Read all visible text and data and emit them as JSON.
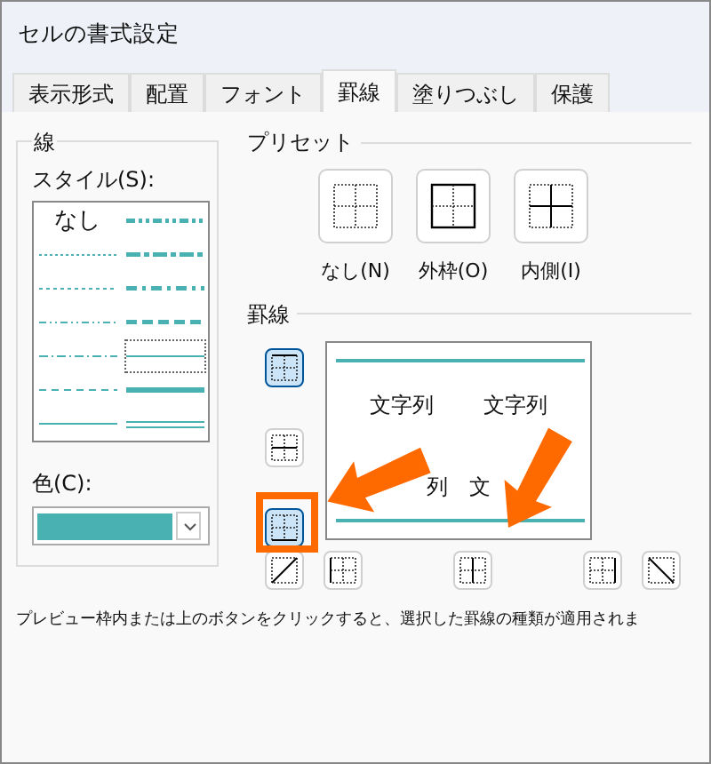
{
  "window": {
    "title": "セルの書式設定"
  },
  "tabs": [
    {
      "label": "表示形式",
      "selected": false
    },
    {
      "label": "配置",
      "selected": false
    },
    {
      "label": "フォント",
      "selected": false
    },
    {
      "label": "罫線",
      "selected": true
    },
    {
      "label": "塗りつぶし",
      "selected": false
    },
    {
      "label": "保護",
      "selected": false
    }
  ],
  "line": {
    "group_label": "線",
    "style_label": "スタイル(S):",
    "styles": [
      {
        "kind": "none",
        "label": "なし",
        "selected": false
      },
      {
        "kind": "hair",
        "selected": false
      },
      {
        "kind": "dotted",
        "selected": false
      },
      {
        "kind": "dashdotdot",
        "selected": false
      },
      {
        "kind": "dashdot",
        "selected": false
      },
      {
        "kind": "dashed",
        "selected": false
      },
      {
        "kind": "thin",
        "selected": false
      },
      {
        "kind": "mediumdashdotdot",
        "selected": false
      },
      {
        "kind": "slantdashdot",
        "selected": false
      },
      {
        "kind": "mediumdashdot",
        "selected": false
      },
      {
        "kind": "mediumdashed",
        "selected": false
      },
      {
        "kind": "thin",
        "selected": true
      },
      {
        "kind": "medium",
        "selected": false
      },
      {
        "kind": "double",
        "selected": false
      }
    ],
    "color_label": "色(C):",
    "color": "#4ab1b3"
  },
  "presets": {
    "label": "プリセット",
    "items": [
      {
        "kind": "none",
        "label": "なし(N)"
      },
      {
        "kind": "outline",
        "label": "外枠(O)"
      },
      {
        "kind": "inside",
        "label": "内側(I)"
      }
    ]
  },
  "border": {
    "label": "罫線",
    "buttons": [
      {
        "kind": "top",
        "selected": true
      },
      {
        "kind": "middle",
        "selected": false
      },
      {
        "kind": "bottom",
        "selected": true
      },
      {
        "kind": "diagup",
        "selected": false
      },
      {
        "kind": "left",
        "selected": false
      },
      {
        "kind": "center",
        "selected": false
      },
      {
        "kind": "right",
        "selected": false
      },
      {
        "kind": "diagdown",
        "selected": false
      }
    ],
    "preview_texts": [
      "文字列",
      "文字列",
      "列",
      "文"
    ]
  },
  "hint": "プレビュー枠内または上のボタンをクリックすると、選択した罫線の種類が適用されま"
}
